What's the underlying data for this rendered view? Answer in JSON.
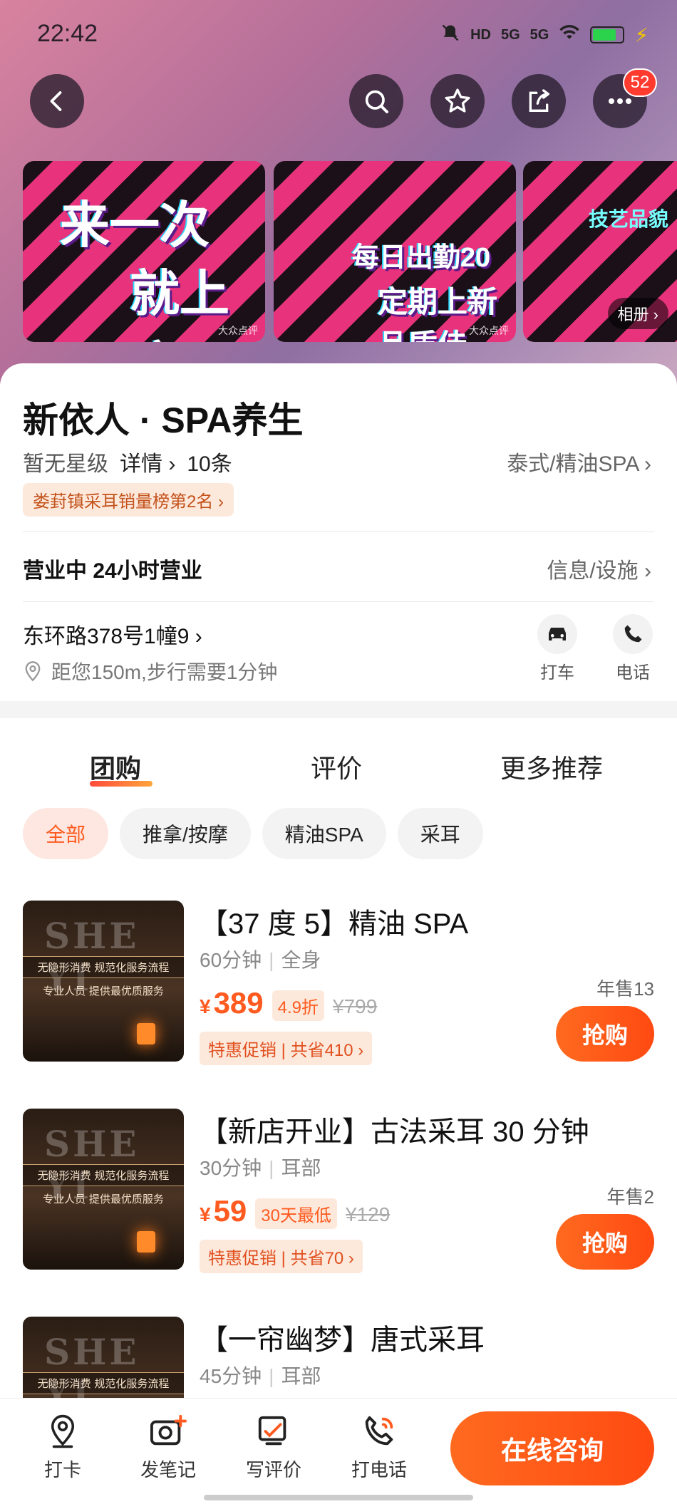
{
  "status_bar": {
    "time": "22:42",
    "network": "5G",
    "hd": "HD"
  },
  "header": {
    "badge_count": "52"
  },
  "banners": [
    {
      "line1": "来一次",
      "line2": "就上瘾",
      "watermark": "大众点评"
    },
    {
      "line1": "每日出勤20",
      "line2": "定期上新品质佳",
      "watermark": "大众点评"
    },
    {
      "line1": "技艺品貌",
      "album_label": "相册"
    }
  ],
  "shop": {
    "name": "新依人 · SPA养生",
    "star_level": "暂无星级",
    "detail_label": "详情",
    "review_count": "10条",
    "category": "泰式/精油SPA",
    "rank_tag": "娄葑镇采耳销量榜第2名",
    "status": "营业中 24小时营业",
    "info_link": "信息/设施",
    "address": "东环路378号1幢9",
    "distance": "距您150m,步行需要1分钟",
    "taxi_label": "打车",
    "phone_label": "电话"
  },
  "tabs": [
    "团购",
    "评价",
    "更多推荐"
  ],
  "chips": [
    "全部",
    "推拿/按摩",
    "精油SPA",
    "采耳"
  ],
  "thumb": {
    "big": "SHE YI",
    "line1": "无隐形消费 规范化服务流程",
    "line2": "专业人员 提供最优质服务"
  },
  "deals": [
    {
      "title": "【37 度 5】精油 SPA",
      "duration": "60分钟",
      "part": "全身",
      "price": "389",
      "discount": "4.9折",
      "original": "¥799",
      "promo": "特惠促销 | 共省410",
      "sold": "年售13",
      "buy": "抢购"
    },
    {
      "title": "【新店开业】古法采耳 30 分钟",
      "duration": "30分钟",
      "part": "耳部",
      "price": "59",
      "discount": "30天最低",
      "original": "¥129",
      "promo": "特惠促销 | 共省70",
      "sold": "年售2",
      "buy": "抢购"
    },
    {
      "title": "【一帘幽梦】唐式采耳",
      "duration": "45分钟",
      "part": "耳部"
    }
  ],
  "bottom_bar": {
    "checkin": "打卡",
    "note": "发笔记",
    "review": "写评价",
    "call": "打电话",
    "consult": "在线咨询"
  },
  "colors": {
    "accent": "#ff5a1f",
    "banner_pink": "#e8337c"
  }
}
